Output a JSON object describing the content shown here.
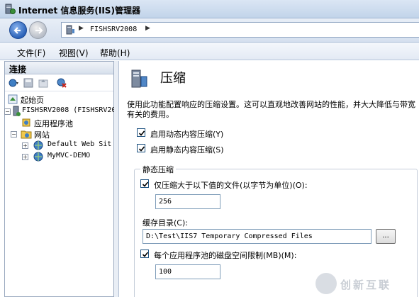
{
  "window": {
    "title": "Internet 信息服务(IIS)管理器"
  },
  "address": {
    "crumbs": [
      "FISHSRV2008"
    ]
  },
  "menu": {
    "items": [
      "文件(F)",
      "视图(V)",
      "帮助(H)"
    ]
  },
  "connections": {
    "header": "连接",
    "tree": {
      "start_page": "起始页",
      "server": "FISHSRV2008 (FISHSRV20",
      "app_pools": "应用程序池",
      "sites": "网站",
      "site1": "Default Web Sit",
      "site2": "MyMVC-DEMO"
    }
  },
  "page": {
    "title": "压缩",
    "description": "使用此功能配置响应的压缩设置。这可以直观地改善网站的性能，并大大降低与带宽有关的费用。",
    "dynamic_compression": {
      "label": "启用动态内容压缩(Y)",
      "checked": true
    },
    "static_compression": {
      "label": "启用静态内容压缩(S)",
      "checked": true
    },
    "static_group": {
      "legend": "静态压缩",
      "min_size": {
        "label": "仅压缩大于以下值的文件(以字节为单位)(O):",
        "checked": true,
        "value": "256"
      },
      "cache_dir": {
        "label": "缓存目录(C):",
        "value": "D:\\Test\\IIS7 Temporary Compressed Files",
        "browse_label": "..."
      },
      "disk_limit": {
        "label": "每个应用程序池的磁盘空间限制(MB)(M):",
        "checked": true,
        "value": "100"
      }
    }
  },
  "watermark": {
    "text": "创新互联"
  },
  "colors": {
    "titlebar": "#c2d4ea",
    "accent_blue": "#2b62b8",
    "pane_border": "#9aa9bf"
  }
}
